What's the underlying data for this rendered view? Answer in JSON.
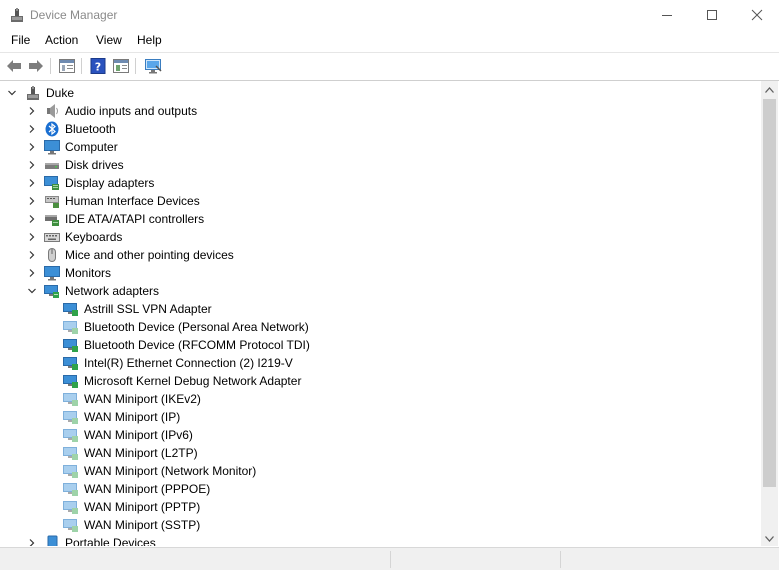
{
  "window": {
    "title": "Device Manager"
  },
  "menu": [
    "File",
    "Action",
    "View",
    "Help"
  ],
  "toolbar_icons": [
    "back-arrow-icon",
    "forward-arrow-icon",
    "properties-icon",
    "help-icon",
    "console-tree-icon",
    "monitor-icon"
  ],
  "tree": {
    "root": "Duke",
    "categories": [
      {
        "label": "Audio inputs and outputs",
        "icon": "speaker-icon"
      },
      {
        "label": "Bluetooth",
        "icon": "bluetooth-icon"
      },
      {
        "label": "Computer",
        "icon": "computer-icon"
      },
      {
        "label": "Disk drives",
        "icon": "disk-drive-icon"
      },
      {
        "label": "Display adapters",
        "icon": "display-adapter-icon"
      },
      {
        "label": "Human Interface Devices",
        "icon": "hid-icon"
      },
      {
        "label": "IDE ATA/ATAPI controllers",
        "icon": "ide-controller-icon"
      },
      {
        "label": "Keyboards",
        "icon": "keyboard-icon"
      },
      {
        "label": "Mice and other pointing devices",
        "icon": "mouse-icon"
      },
      {
        "label": "Monitors",
        "icon": "monitor-icon"
      },
      {
        "label": "Network adapters",
        "icon": "network-adapter-icon",
        "expanded": true
      }
    ],
    "network_adapters": [
      "Astrill SSL VPN Adapter",
      "Bluetooth Device (Personal Area Network)",
      "Bluetooth Device (RFCOMM Protocol TDI)",
      "Intel(R) Ethernet Connection (2) I219-V",
      "Microsoft Kernel Debug Network Adapter",
      "WAN Miniport (IKEv2)",
      "WAN Miniport (IP)",
      "WAN Miniport (IPv6)",
      "WAN Miniport (L2TP)",
      "WAN Miniport (Network Monitor)",
      "WAN Miniport (PPPOE)",
      "WAN Miniport (PPTP)",
      "WAN Miniport (SSTP)"
    ],
    "after_categories": [
      {
        "label": "Portable Devices",
        "icon": "portable-device-icon"
      }
    ]
  },
  "colors": {
    "title_text": "#8a8a8a",
    "monitor_blue": "#3c8fd6",
    "network_green": "#2fa24a"
  }
}
